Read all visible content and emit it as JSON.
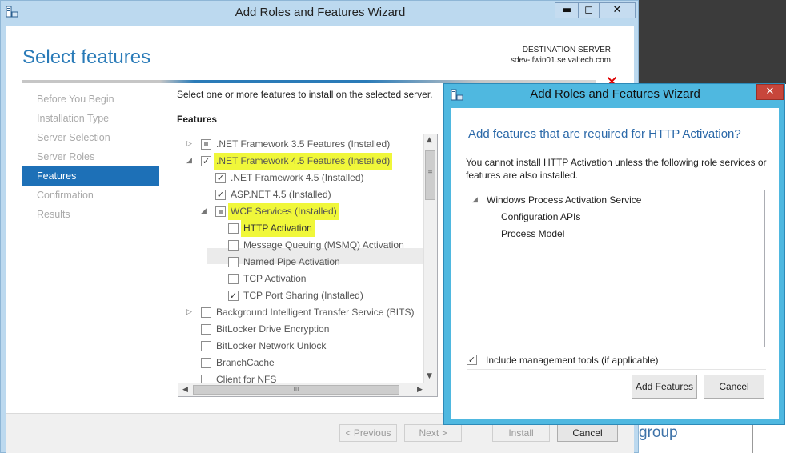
{
  "main_window": {
    "title": "Add Roles and Features Wizard",
    "page_title": "Select features",
    "destination_label": "DESTINATION SERVER",
    "destination_server": "sdev-lfwin01.se.valtech.com",
    "instruction": "Select one or more features to install on the selected server.",
    "features_label": "Features",
    "caption_buttons": {
      "minimize": "▬",
      "maximize": "◻",
      "close": "✕"
    }
  },
  "nav": {
    "items": [
      {
        "label": "Before You Begin",
        "active": false
      },
      {
        "label": "Installation Type",
        "active": false
      },
      {
        "label": "Server Selection",
        "active": false
      },
      {
        "label": "Server Roles",
        "active": false
      },
      {
        "label": "Features",
        "active": true
      },
      {
        "label": "Confirmation",
        "active": false
      },
      {
        "label": "Results",
        "active": false
      }
    ]
  },
  "tree": {
    "rows": [
      {
        "label": ".NET Framework 3.5 Features (Installed)",
        "indent": 0,
        "expander": "▷",
        "state": "partial",
        "highlight": false
      },
      {
        "label": ".NET Framework 4.5 Features (Installed)",
        "indent": 0,
        "expander": "◢",
        "state": "checked",
        "highlight": true
      },
      {
        "label": ".NET Framework 4.5 (Installed)",
        "indent": 1,
        "expander": "",
        "state": "checked",
        "highlight": false
      },
      {
        "label": "ASP.NET 4.5 (Installed)",
        "indent": 1,
        "expander": "",
        "state": "checked",
        "highlight": false
      },
      {
        "label": "WCF Services (Installed)",
        "indent": 1,
        "expander": "◢",
        "state": "partial",
        "highlight": true
      },
      {
        "label": "HTTP Activation",
        "indent": 2,
        "expander": "",
        "state": "unchecked",
        "highlight": true,
        "selected": true
      },
      {
        "label": "Message Queuing (MSMQ) Activation",
        "indent": 2,
        "expander": "",
        "state": "unchecked",
        "highlight": false
      },
      {
        "label": "Named Pipe Activation",
        "indent": 2,
        "expander": "",
        "state": "unchecked",
        "highlight": false
      },
      {
        "label": "TCP Activation",
        "indent": 2,
        "expander": "",
        "state": "unchecked",
        "highlight": false
      },
      {
        "label": "TCP Port Sharing (Installed)",
        "indent": 2,
        "expander": "",
        "state": "checked",
        "highlight": false
      },
      {
        "label": "Background Intelligent Transfer Service (BITS)",
        "indent": 0,
        "expander": "▷",
        "state": "unchecked",
        "highlight": false
      },
      {
        "label": "BitLocker Drive Encryption",
        "indent": 0,
        "expander": "",
        "state": "unchecked",
        "highlight": false
      },
      {
        "label": "BitLocker Network Unlock",
        "indent": 0,
        "expander": "",
        "state": "unchecked",
        "highlight": false
      },
      {
        "label": "BranchCache",
        "indent": 0,
        "expander": "",
        "state": "unchecked",
        "highlight": false
      },
      {
        "label": "Client for NFS",
        "indent": 0,
        "expander": "",
        "state": "unchecked",
        "highlight": false
      }
    ],
    "vertical_scroll_thumb_glyph": "≡",
    "horizontal_scroll_thumb_glyph": "III"
  },
  "buttons": {
    "previous": "< Previous",
    "next": "Next >",
    "install": "Install",
    "cancel": "Cancel"
  },
  "dialog": {
    "title": "Add Roles and Features Wizard",
    "heading": "Add features that are required for HTTP Activation?",
    "description": "You cannot install HTTP Activation unless the following role services or features are also installed.",
    "list": [
      {
        "label": "Windows Process Activation Service",
        "indent": 0,
        "expander": "◢"
      },
      {
        "label": "Configuration APIs",
        "indent": 1,
        "expander": ""
      },
      {
        "label": "Process Model",
        "indent": 1,
        "expander": ""
      }
    ],
    "include_tools_label": "Include management tools (if applicable)",
    "include_tools_checked": true,
    "add_button": "Add Features",
    "cancel_button": "Cancel",
    "close_glyph": "✕"
  },
  "background": {
    "partial_text": "group"
  },
  "colors": {
    "accent": "#1d70b7",
    "title_blue": "#2a7bb8",
    "highlight": "#f0f73a",
    "dialog_frame": "#4fb8e0",
    "close_red": "#c7463b"
  }
}
